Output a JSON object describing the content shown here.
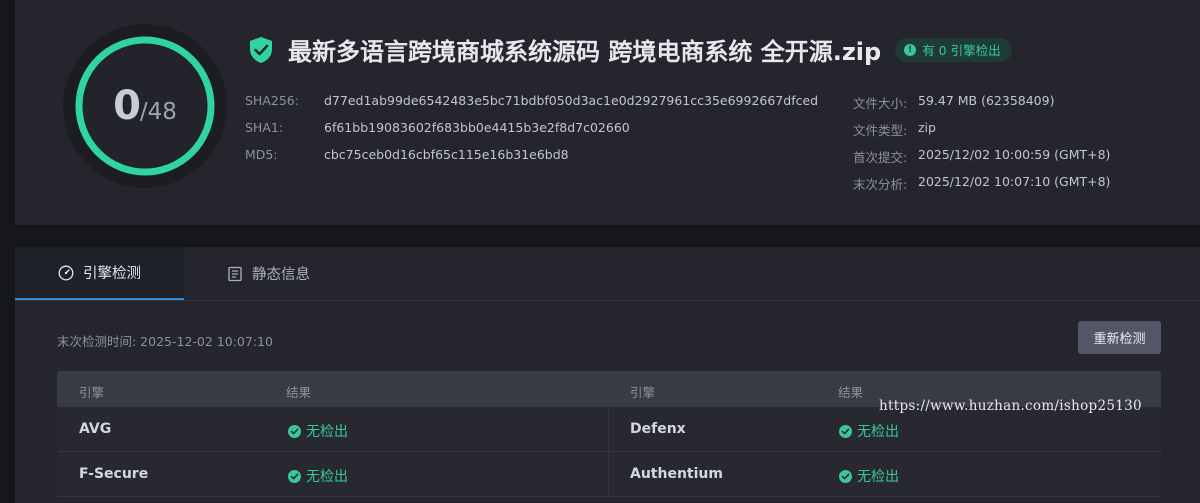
{
  "gauge": {
    "detected": "0",
    "total": "/48",
    "color": "#2fd4a0"
  },
  "file": {
    "title": "最新多语言跨境商城系统源码 跨境电商系统 全开源.zip",
    "status_badge": "有 0 引擎检出",
    "status_color": "#39c89a"
  },
  "hashes": {
    "sha256_label": "SHA256:",
    "sha256": "d77ed1ab99de6542483e5bc71bdbf050d3ac1e0d2927961cc35e6992667dfced",
    "sha1_label": "SHA1:",
    "sha1": "6f61bb19083602f683bb0e4415b3e2f8d7c02660",
    "md5_label": "MD5:",
    "md5": "cbc75ceb0d16cbf65c115e16b31e6bd8"
  },
  "meta": {
    "size_label": "文件大小:",
    "size": "59.47 MB (62358409)",
    "type_label": "文件类型:",
    "type": "zip",
    "first_label": "首次提交:",
    "first": "2025/12/02 10:00:59 (GMT+8)",
    "last_label": "末次分析:",
    "last": "2025/12/02 10:07:10 (GMT+8)"
  },
  "tabs": [
    {
      "label": "引擎检测",
      "icon": "gauge-icon",
      "active": true
    },
    {
      "label": "静态信息",
      "icon": "document-icon",
      "active": false
    }
  ],
  "scan": {
    "last_check": "末次检测时间: 2025-12-02 10:07:10",
    "rescan": "重新检测"
  },
  "table": {
    "headers": [
      "引擎",
      "结果",
      "引擎",
      "结果"
    ],
    "rows": [
      {
        "left_engine": "AVG",
        "left_result": "无检出",
        "right_engine": "Defenx",
        "right_result": "无检出"
      },
      {
        "left_engine": "F-Secure",
        "left_result": "无检出",
        "right_engine": "Authentium",
        "right_result": "无检出"
      }
    ]
  },
  "watermark": "https://www.huzhan.com/ishop25130"
}
